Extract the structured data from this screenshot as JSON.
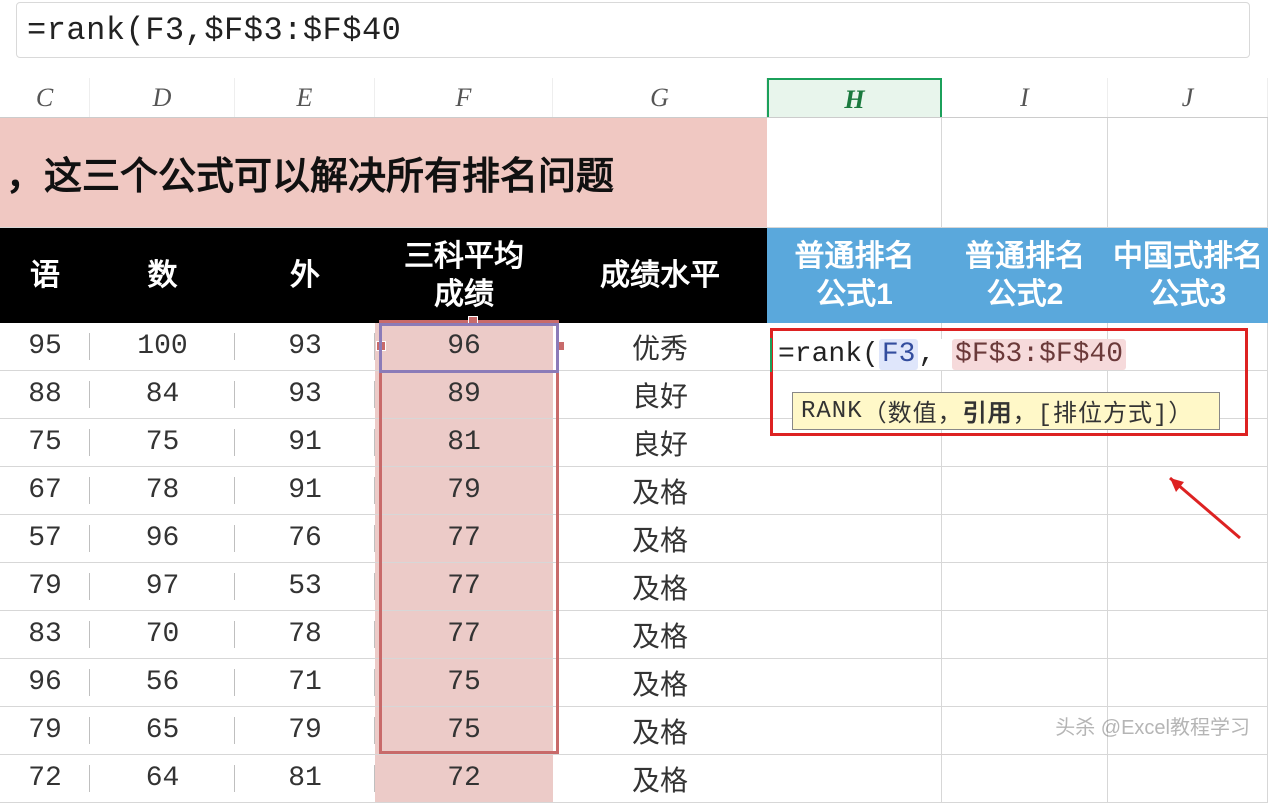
{
  "formula_bar": "=rank(F3,$F$3:$F$40",
  "columns": [
    "C",
    "D",
    "E",
    "F",
    "G",
    "H",
    "I",
    "J"
  ],
  "selected_col": "H",
  "banner_text": "，这三个公式可以解决所有排名问题",
  "headers": {
    "C": "语",
    "D": "数",
    "E": "外",
    "F": "三科平均\n成绩",
    "G": "成绩水平",
    "H": "普通排名\n公式1",
    "I": "普通排名\n公式2",
    "J": "中国式排名\n公式3"
  },
  "rows": [
    {
      "C": "95",
      "D": "100",
      "E": "93",
      "F": "96",
      "G": "优秀"
    },
    {
      "C": "88",
      "D": "84",
      "E": "93",
      "F": "89",
      "G": "良好"
    },
    {
      "C": "75",
      "D": "75",
      "E": "91",
      "F": "81",
      "G": "良好"
    },
    {
      "C": "67",
      "D": "78",
      "E": "91",
      "F": "79",
      "G": "及格"
    },
    {
      "C": "57",
      "D": "96",
      "E": "76",
      "F": "77",
      "G": "及格"
    },
    {
      "C": "79",
      "D": "97",
      "E": "53",
      "F": "77",
      "G": "及格"
    },
    {
      "C": "83",
      "D": "70",
      "E": "78",
      "F": "77",
      "G": "及格"
    },
    {
      "C": "96",
      "D": "56",
      "E": "71",
      "F": "75",
      "G": "及格"
    },
    {
      "C": "79",
      "D": "65",
      "E": "79",
      "F": "75",
      "G": "及格"
    },
    {
      "C": "72",
      "D": "64",
      "E": "81",
      "F": "72",
      "G": "及格"
    }
  ],
  "overlay": {
    "prefix": "=rank(",
    "arg1": "F3",
    "comma": ", ",
    "arg2": "$F$3:$F$40"
  },
  "hint": {
    "fn": "RANK",
    "open": "（",
    "p1": "数值，",
    "p2": "引用",
    "p3": "，[排位方式]）"
  },
  "watermark": "头杀 @Excel教程学习"
}
